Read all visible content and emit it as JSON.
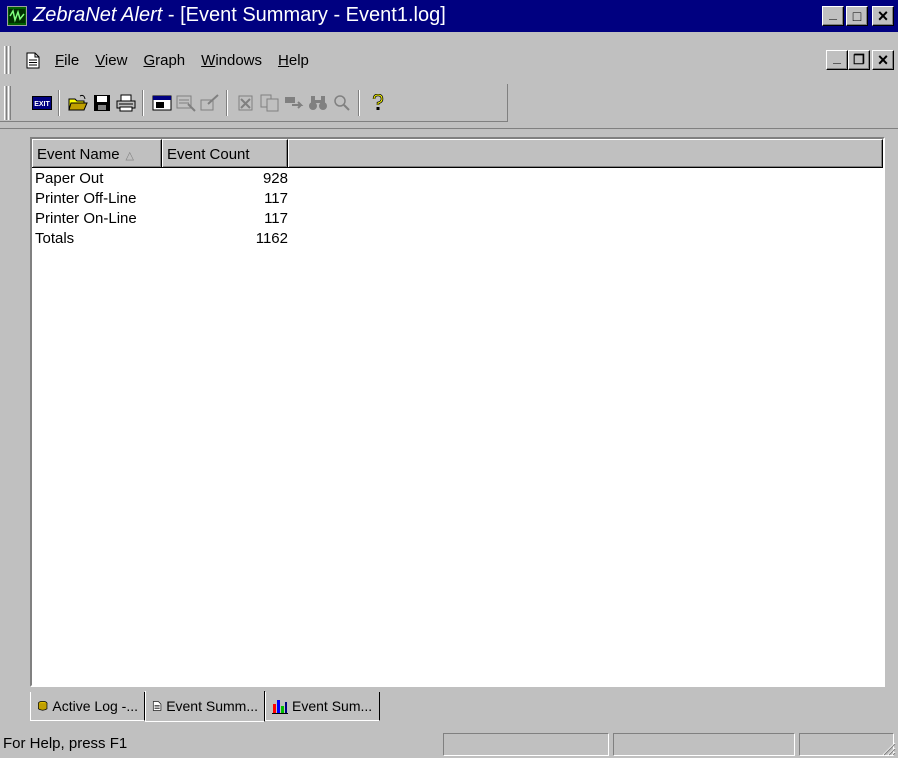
{
  "window": {
    "title_app": "ZebraNet Alert",
    "title_rest": " - [Event Summary - Event1.log]",
    "minimize_label": "_",
    "maximize_label": "□",
    "close_label": "×"
  },
  "menu": {
    "items": [
      {
        "label": "File",
        "mnemonic": "F"
      },
      {
        "label": "View",
        "mnemonic": "V"
      },
      {
        "label": "Graph",
        "mnemonic": "G"
      },
      {
        "label": "Windows",
        "mnemonic": "W"
      },
      {
        "label": "Help",
        "mnemonic": "H"
      }
    ],
    "child_minimize_label": "_",
    "child_restore_label": "❐",
    "child_close_label": "×"
  },
  "toolbar": {
    "buttons": [
      {
        "name": "exit",
        "icon": "exit-icon",
        "label": "EXIT"
      },
      {
        "name": "open",
        "icon": "open-folder-icon"
      },
      {
        "name": "save",
        "icon": "save-icon"
      },
      {
        "name": "print",
        "icon": "print-icon"
      },
      {
        "name": "view-log",
        "icon": "window-icon"
      },
      {
        "name": "filter",
        "icon": "filter-icon"
      },
      {
        "name": "wand",
        "icon": "wand-icon"
      },
      {
        "name": "cut",
        "icon": "cut-icon"
      },
      {
        "name": "copy",
        "icon": "copy-icon"
      },
      {
        "name": "route",
        "icon": "route-icon"
      },
      {
        "name": "find",
        "icon": "binoculars-icon"
      },
      {
        "name": "zoom",
        "icon": "magnifier-icon"
      },
      {
        "name": "help",
        "icon": "help-icon"
      }
    ]
  },
  "list": {
    "columns": [
      {
        "label": "Event Name",
        "sorted": true
      },
      {
        "label": "Event Count"
      }
    ],
    "rows": [
      {
        "name": "Paper Out",
        "count": "928"
      },
      {
        "name": "Printer Off-Line",
        "count": "117"
      },
      {
        "name": "Printer On-Line",
        "count": "117"
      },
      {
        "name": "Totals",
        "count": "1162"
      }
    ]
  },
  "tabs": [
    {
      "label": "Active Log -...",
      "icon": "database-icon"
    },
    {
      "label": "Event Summ...",
      "icon": "document-icon",
      "active": true
    },
    {
      "label": "Event Sum...",
      "icon": "bar-chart-icon"
    }
  ],
  "status": {
    "text": "For Help, press F1"
  },
  "colors": {
    "titlebar": "#000080",
    "face": "#c0c0c0"
  }
}
